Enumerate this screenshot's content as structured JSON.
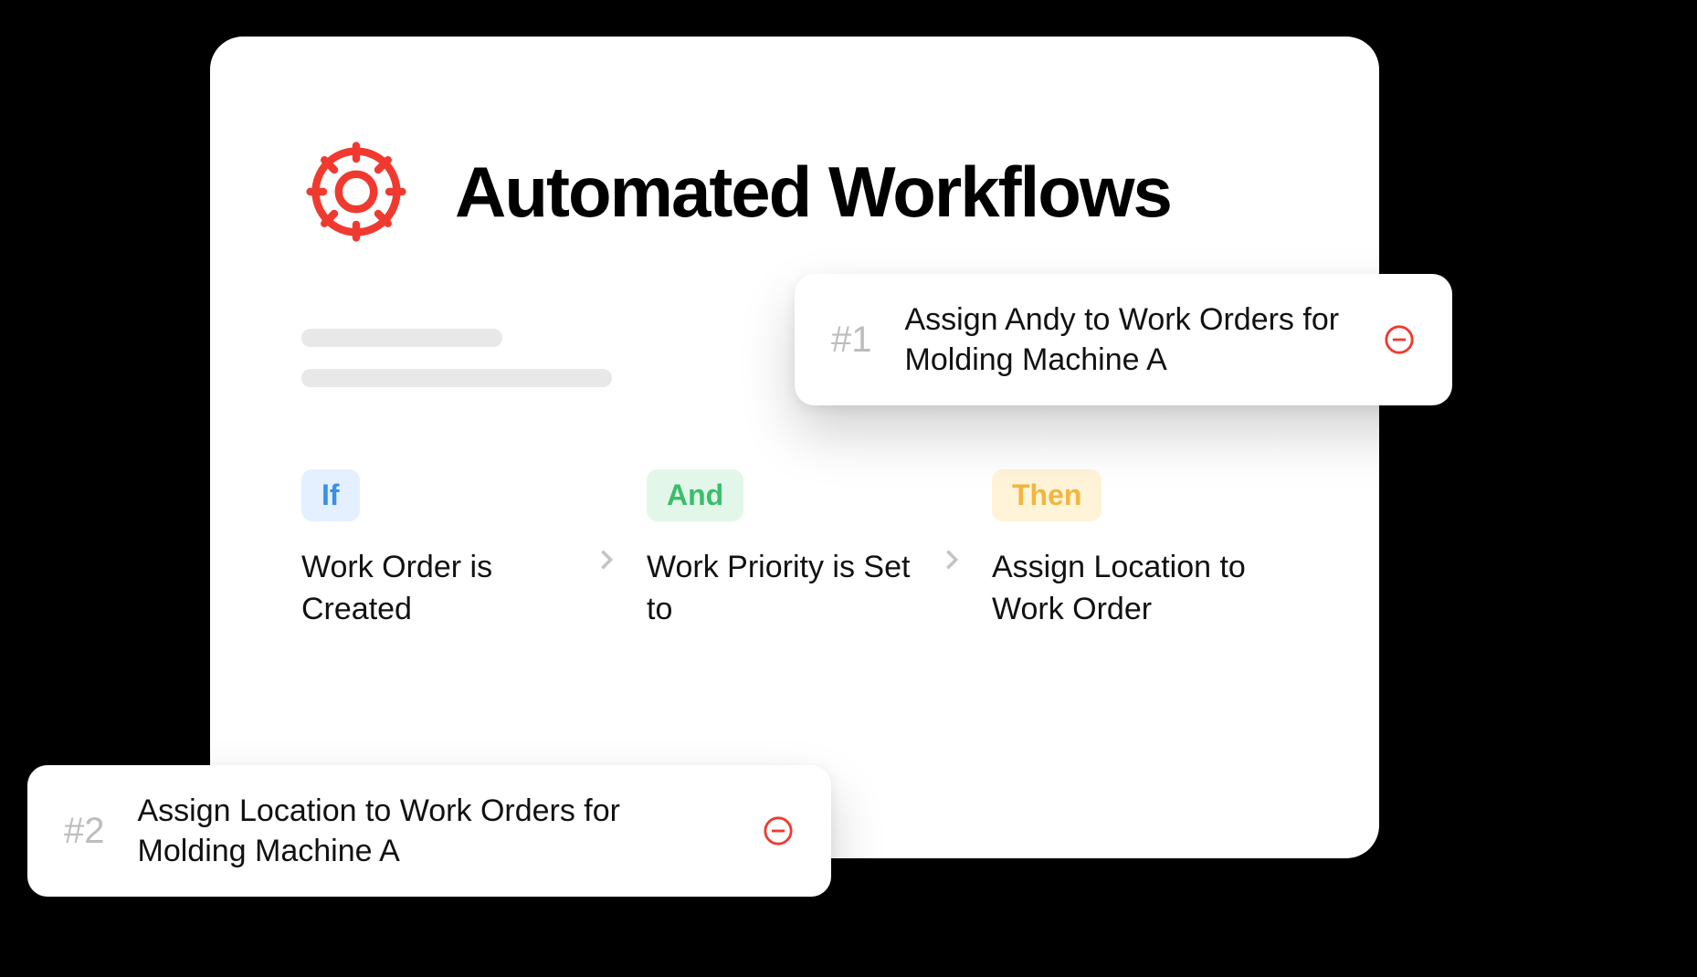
{
  "header": {
    "title": "Automated Workflows"
  },
  "rules": {
    "if_label": "If",
    "if_text": "Work Order is Created",
    "and_label": "And",
    "and_text": "Work Priority is Set to",
    "then_label": "Then",
    "then_text": "Assign Location to Work Order"
  },
  "workflows": [
    {
      "num": "#1",
      "title": "Assign Andy to Work Orders for Molding Machine A"
    },
    {
      "num": "#2",
      "title": "Assign Location to Work Orders for Molding Machine A"
    }
  ],
  "colors": {
    "accent_red": "#f03a2f"
  }
}
